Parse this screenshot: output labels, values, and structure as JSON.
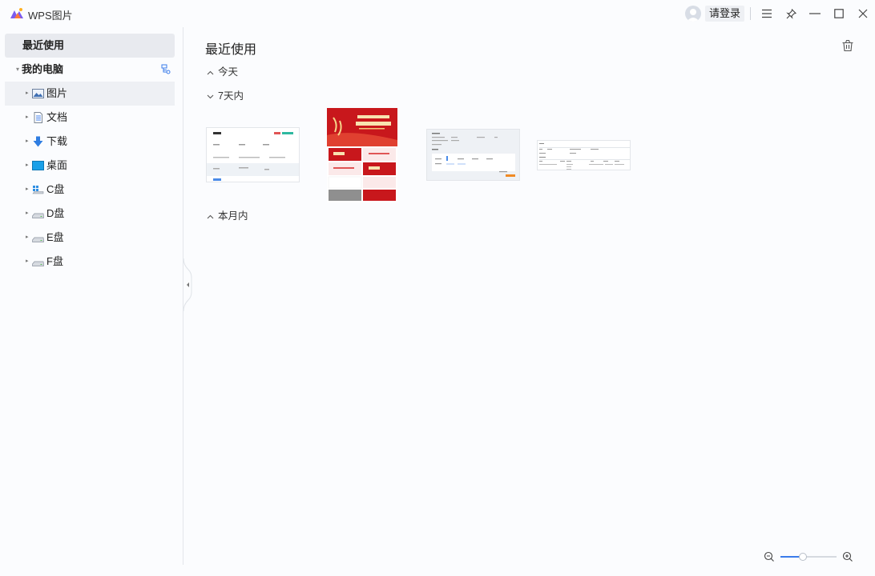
{
  "window": {
    "title": "WPS图片",
    "login_label": "请登录",
    "accent": "#3a7bea"
  },
  "sidebar": {
    "recent_label": "最近使用",
    "my_computer_label": "我的电脑",
    "items": [
      {
        "label": "图片",
        "icon": "pictures-folder-icon"
      },
      {
        "label": "文档",
        "icon": "documents-folder-icon"
      },
      {
        "label": "下载",
        "icon": "download-folder-icon"
      },
      {
        "label": "桌面",
        "icon": "desktop-folder-icon"
      },
      {
        "label": "C盘",
        "icon": "system-drive-icon"
      },
      {
        "label": "D盘",
        "icon": "drive-icon"
      },
      {
        "label": "E盘",
        "icon": "drive-icon"
      },
      {
        "label": "F盘",
        "icon": "drive-icon"
      }
    ]
  },
  "main": {
    "title": "最近使用",
    "groups": [
      {
        "label": "今天",
        "expanded": false
      },
      {
        "label": "7天内",
        "expanded": true
      },
      {
        "label": "本月内",
        "expanded": false
      }
    ],
    "thumbnails": [
      {
        "kind": "web-form-screenshot"
      },
      {
        "kind": "red-poster"
      },
      {
        "kind": "web-settings-screenshot"
      },
      {
        "kind": "web-table-screenshot"
      }
    ]
  },
  "zoom": {
    "level_fraction": 0.4
  }
}
